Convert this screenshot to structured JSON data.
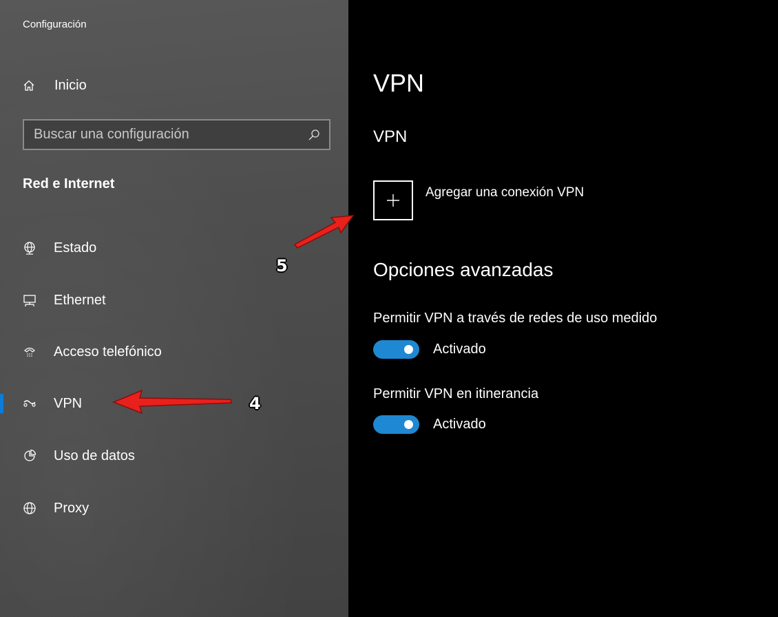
{
  "window": {
    "title": "Configuración"
  },
  "sidebar": {
    "home": {
      "label": "Inicio",
      "icon": "home-icon"
    },
    "search": {
      "placeholder": "Buscar una configuración",
      "value": "",
      "icon": "search-icon"
    },
    "section_title": "Red e Internet",
    "items": [
      {
        "label": "Estado",
        "icon": "globe-status-icon",
        "selected": false
      },
      {
        "label": "Ethernet",
        "icon": "ethernet-icon",
        "selected": false
      },
      {
        "label": "Acceso telefónico",
        "icon": "dial-up-icon",
        "selected": false
      },
      {
        "label": "VPN",
        "icon": "vpn-icon",
        "selected": true
      },
      {
        "label": "Uso de datos",
        "icon": "pie-chart-icon",
        "selected": false
      },
      {
        "label": "Proxy",
        "icon": "globe-icon",
        "selected": false
      }
    ]
  },
  "main": {
    "page_title": "VPN",
    "section_title": "VPN",
    "add_connection": {
      "label": "Agregar una conexión VPN",
      "icon": "plus-icon"
    },
    "advanced_title": "Opciones avanzadas",
    "options": [
      {
        "label": "Permitir VPN a través de redes de uso medido",
        "state": "Activado",
        "on": true
      },
      {
        "label": "Permitir VPN en itinerancia",
        "state": "Activado",
        "on": true
      }
    ]
  },
  "annotations": [
    {
      "number": "4",
      "points_to": "VPN"
    },
    {
      "number": "5",
      "points_to": "Agregar una conexión VPN"
    }
  ],
  "colors": {
    "accent": "#0078d7",
    "toggle_on": "#1e88d2",
    "arrow": "#e8211d",
    "sidebar_bg": "#4e4e4e",
    "main_bg": "#000000"
  }
}
